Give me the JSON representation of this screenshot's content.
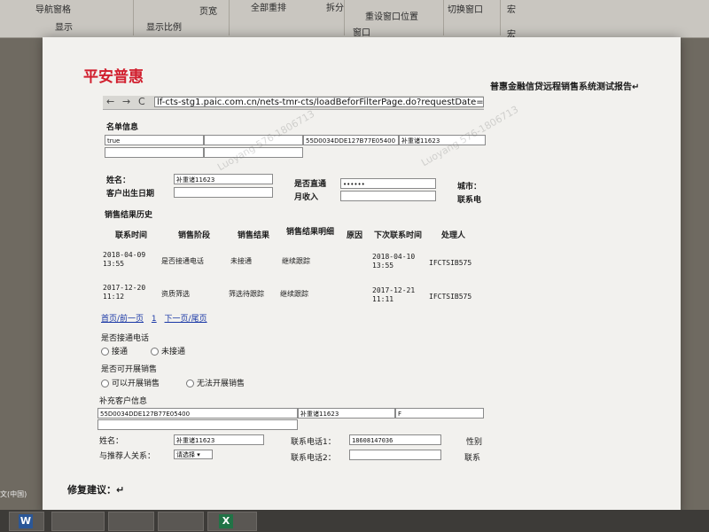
{
  "ribbon": {
    "items": [
      "导航窗格",
      "显示",
      "页宽",
      "显示比例",
      "全部重排",
      "拆分",
      "重设窗口位置",
      "窗口",
      "切换窗口",
      "宏",
      "宏"
    ]
  },
  "document": {
    "logo": "平安普惠",
    "title": "普惠金融信贷远程销售系统测试报告↵",
    "url": "lf-cts-stg1.paic.com.cn/nets-tmr-cts/loadBeforFilterPage.do?requestDate=",
    "nav": {
      "back": "←",
      "forward": "→",
      "refresh": "C"
    },
    "list_info": {
      "heading": "名单信息",
      "fields": [
        "true",
        "",
        "55D0034DDE127B77E05400",
        "补重诸11623"
      ]
    },
    "customer": {
      "name_label": "姓名：",
      "name_value": "补重诸11623",
      "dob_label": "客户出生日期",
      "dob_value": "",
      "direct_label": "是否直通",
      "direct_value": "••••••",
      "income_label": "月收入",
      "income_value": "",
      "city_label": "城市：",
      "contact_label": "联系电"
    },
    "sales_history": {
      "heading": "销售结果历史",
      "columns": [
        "联系时间",
        "销售阶段",
        "销售结果",
        "销售结果明细",
        "原因",
        "下次联系时间",
        "处理人"
      ],
      "rows": [
        {
          "time": "2018-04-09\n13:55",
          "stage": "是否接通电话",
          "result": "未接通",
          "detail": "继续跟踪",
          "reason": "",
          "next": "2018-04-10\n13:55",
          "handler": "IFCTSIB575"
        },
        {
          "time": "2017-12-20\n11:12",
          "stage": "资质筛选",
          "result": "筛选待跟踪",
          "detail": "继续跟踪",
          "reason": "",
          "next": "2017-12-21\n11:11",
          "handler": "IFCTSIB575"
        }
      ],
      "pager": {
        "first_prev": "首页/前一页",
        "page": "1",
        "next_last": "下一页/尾页"
      }
    },
    "connected": {
      "question": "是否接通电话",
      "options": [
        "接通",
        "未接通"
      ]
    },
    "can_sell": {
      "question": "是否可开展销售",
      "options": [
        "可以开展销售",
        "无法开展销售"
      ]
    },
    "supplement": {
      "heading": "补充客户信息",
      "fields": [
        "55D0034DDE127B77E05400",
        "补重诸11623",
        "F"
      ],
      "name_label": "姓名：",
      "name_value": "补重诸11623",
      "phone1_label": "联系电话1：",
      "phone1_value": "18608147036",
      "gender_label": "性别",
      "relation_label": "与推荐人关系：",
      "relation_value": "请选择",
      "phone2_label": "联系电话2：",
      "phone2_value": "",
      "contact_label": "联系"
    },
    "repair_label": "修复建议：↵"
  },
  "status_bar": {
    "lang": "文(中国)"
  },
  "colors": {
    "logo": "#d11f2e",
    "link": "#1a38a6",
    "paper": "#f2f1ee"
  }
}
